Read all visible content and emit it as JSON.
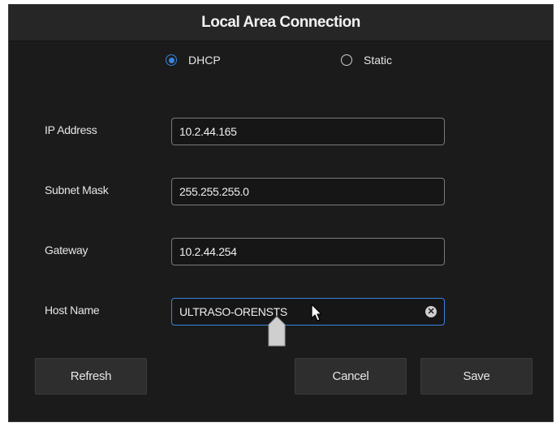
{
  "dialog": {
    "title": "Local Area Connection"
  },
  "mode": {
    "dhcp_label": "DHCP",
    "static_label": "Static",
    "selected": "DHCP"
  },
  "fields": {
    "ip_address": {
      "label": "IP Address",
      "value": "10.2.44.165"
    },
    "subnet_mask": {
      "label": "Subnet Mask",
      "value": "255.255.255.0"
    },
    "gateway": {
      "label": "Gateway",
      "value": "10.2.44.254"
    },
    "host_name": {
      "label": "Host Name",
      "value": "ULTRASO-ORENSTS"
    }
  },
  "buttons": {
    "refresh": "Refresh",
    "cancel": "Cancel",
    "save": "Save"
  },
  "icons": {
    "clear": "clear-icon",
    "pointer": "mouse-pointer-icon",
    "text_handle": "text-cursor-handle-icon"
  },
  "colors": {
    "accent": "#3a83e0",
    "background": "#1b1b1b",
    "titlebar": "#262626",
    "button": "#2e2e2e"
  }
}
